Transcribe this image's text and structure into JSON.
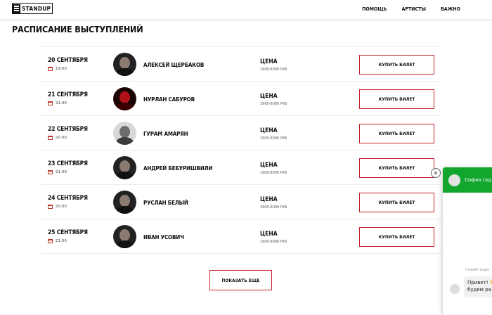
{
  "header": {
    "logo_text": "STANDUP",
    "nav": [
      "ПОМОЩЬ",
      "АРТИСТЫ",
      "ВАЖНО"
    ]
  },
  "page_title": "РАСПИСАНИЕ ВЫСТУПЛЕНИЙ",
  "events": [
    {
      "date": "20 СЕНТЯБРЯ",
      "time": "19:00",
      "artist": "АЛЕКСЕЙ ЩЕРБАКОВ",
      "price_label": "ЦЕНА",
      "price": "1900-6000 РУБ",
      "buy_label": "КУПИТЬ БИЛЕТ"
    },
    {
      "date": "21 СЕНТЯБРЯ",
      "time": "21:00",
      "artist": "НУРЛАН САБУРОВ",
      "price_label": "ЦЕНА",
      "price": "1900-6000 РУБ",
      "buy_label": "КУПИТЬ БИЛЕТ"
    },
    {
      "date": "22 СЕНТЯБРЯ",
      "time": "20:00",
      "artist": "ГУРАМ АМАРЯН",
      "price_label": "ЦЕНА",
      "price": "1900-6000 РУБ",
      "buy_label": "КУПИТЬ БИЛЕТ"
    },
    {
      "date": "23 СЕНТЯБРЯ",
      "time": "21:00",
      "artist": "АНДРЕЙ БЕБУРИШВИЛИ",
      "price_label": "ЦЕНА",
      "price": "1900-8000 РУБ",
      "buy_label": "КУПИТЬ БИЛЕТ"
    },
    {
      "date": "24 СЕНТЯБРЯ",
      "time": "20:00",
      "artist": "РУСЛАН БЕЛЫЙ",
      "price_label": "ЦЕНА",
      "price": "1900-6000 РУБ",
      "buy_label": "КУПИТЬ БИЛЕТ"
    },
    {
      "date": "25 СЕНТЯБРЯ",
      "time": "21:00",
      "artist": "ИВАН УСОВИЧ",
      "price_label": "ЦЕНА",
      "price": "1900-8000 РУБ",
      "buy_label": "КУПИТЬ БИЛЕТ"
    }
  ],
  "show_more_label": "ПОКАЗАТЬ ЕЩЕ",
  "chat": {
    "agent_name": "София (ад",
    "from_label": "София (адм",
    "message_line1": "Привет! 👋",
    "message_line2": "будем ра",
    "close_symbol": "✕"
  },
  "colors": {
    "accent": "#c21f2c",
    "chat_green": "#12a62f",
    "divider": "#ececec"
  },
  "icons": {
    "calendar": "calendar-icon",
    "close": "close-icon"
  }
}
